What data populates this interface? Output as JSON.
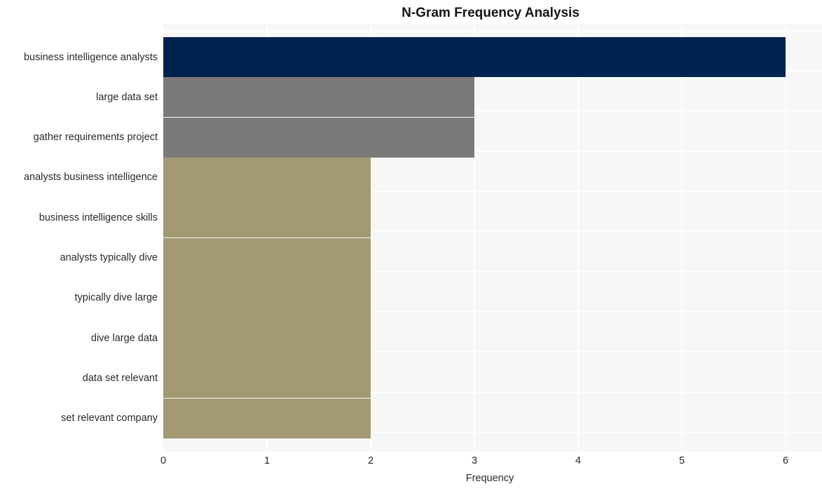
{
  "chart_data": {
    "type": "bar",
    "orientation": "horizontal",
    "title": "N-Gram Frequency Analysis",
    "xlabel": "Frequency",
    "ylabel": "",
    "xlim": [
      0,
      6
    ],
    "xticks": [
      "0",
      "1",
      "2",
      "3",
      "4",
      "5",
      "6"
    ],
    "grid": true,
    "legend": "none",
    "categories": [
      "business intelligence analysts",
      "large data set",
      "gather requirements project",
      "analysts business intelligence",
      "business intelligence skills",
      "analysts typically dive",
      "typically dive large",
      "dive large data",
      "data set relevant",
      "set relevant company"
    ],
    "values": [
      6,
      3,
      3,
      2,
      2,
      2,
      2,
      2,
      2,
      2
    ],
    "bar_colors": [
      "#00224e",
      "#7b7a78",
      "#7b7a78",
      "#a39a72",
      "#a39a72",
      "#a39a72",
      "#a39a72",
      "#a39a72",
      "#a39a72",
      "#a39a72"
    ]
  },
  "style": {
    "plot_background": "#f7f7f7",
    "page_background": "#ffffff",
    "grid_color": "#ffffff",
    "text_color": "#2a2a2a",
    "title_color": "#151515"
  }
}
